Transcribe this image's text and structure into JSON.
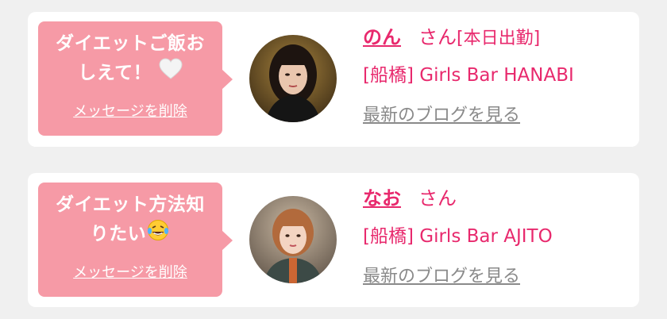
{
  "cards": [
    {
      "message_line1": "ダイエットご飯お",
      "message_line2": "しえて！",
      "message_emoji": "white-heart-icon",
      "delete_label": "メッセージを削除",
      "name": "のん",
      "honorific": "さん",
      "status": "[本日出勤]",
      "shop": "[船橋] Girls Bar HANABI",
      "blog_link": "最新のブログを見る"
    },
    {
      "message_line1": "ダイエット方法知",
      "message_line2": "りたい",
      "message_emoji": "laughing-tears-icon",
      "delete_label": "メッセージを削除",
      "name": "なお",
      "honorific": "さん",
      "status": "",
      "shop": "[船橋] Girls Bar AJITO",
      "blog_link": "最新のブログを見る"
    }
  ],
  "colors": {
    "page_bg": "#f0f0f0",
    "bubble": "#f69aa6",
    "accent": "#e8296d",
    "muted": "#8a8a8a"
  }
}
